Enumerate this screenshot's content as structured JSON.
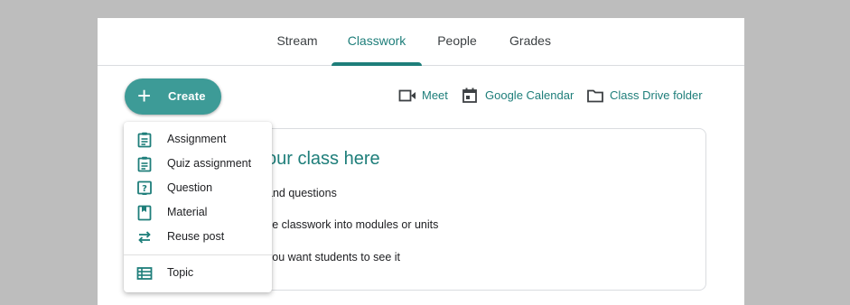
{
  "tabs": [
    {
      "label": "Stream"
    },
    {
      "label": "Classwork"
    },
    {
      "label": "People"
    },
    {
      "label": "Grades"
    }
  ],
  "active_tab": "Classwork",
  "create_button": {
    "icon": "plus-icon",
    "label": "Create"
  },
  "links": {
    "meet": {
      "icon": "video-camera-icon",
      "label": "Meet"
    },
    "calendar": {
      "icon": "calendar-icon",
      "label": "Google Calendar"
    },
    "drive": {
      "icon": "folder-icon",
      "label": "Class Drive folder"
    }
  },
  "card": {
    "title": "our class here",
    "lines": [
      "and questions",
      "ze classwork into modules or units",
      "you want students to see it"
    ]
  },
  "create_menu": {
    "items": [
      {
        "icon": "assignment-icon",
        "label": "Assignment"
      },
      {
        "icon": "quiz-assignment-icon",
        "label": "Quiz assignment"
      },
      {
        "icon": "question-icon",
        "label": "Question"
      },
      {
        "icon": "material-icon",
        "label": "Material"
      },
      {
        "icon": "reuse-post-icon",
        "label": "Reuse post"
      }
    ],
    "topic": {
      "icon": "topic-icon",
      "label": "Topic"
    }
  },
  "colors": {
    "accent": "#1e7e7a",
    "button": "#3d9b97",
    "backdrop": "#bdbdbd"
  }
}
